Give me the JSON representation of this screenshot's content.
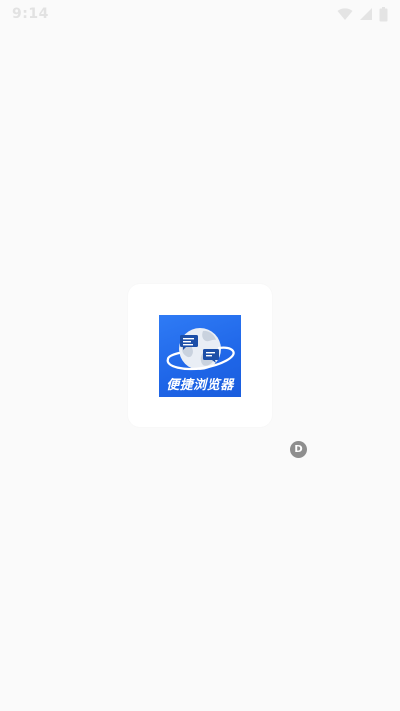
{
  "status_bar": {
    "time": "9:14",
    "icons": [
      "wifi-icon",
      "signal-icon",
      "battery-icon"
    ]
  },
  "splash": {
    "logo_text": "便捷浏览器",
    "logo_colors": {
      "background": "#2f7bf5",
      "globe": "#e8eef6",
      "ring": "#ffffff"
    }
  },
  "debug_badge": {
    "label": "D"
  }
}
